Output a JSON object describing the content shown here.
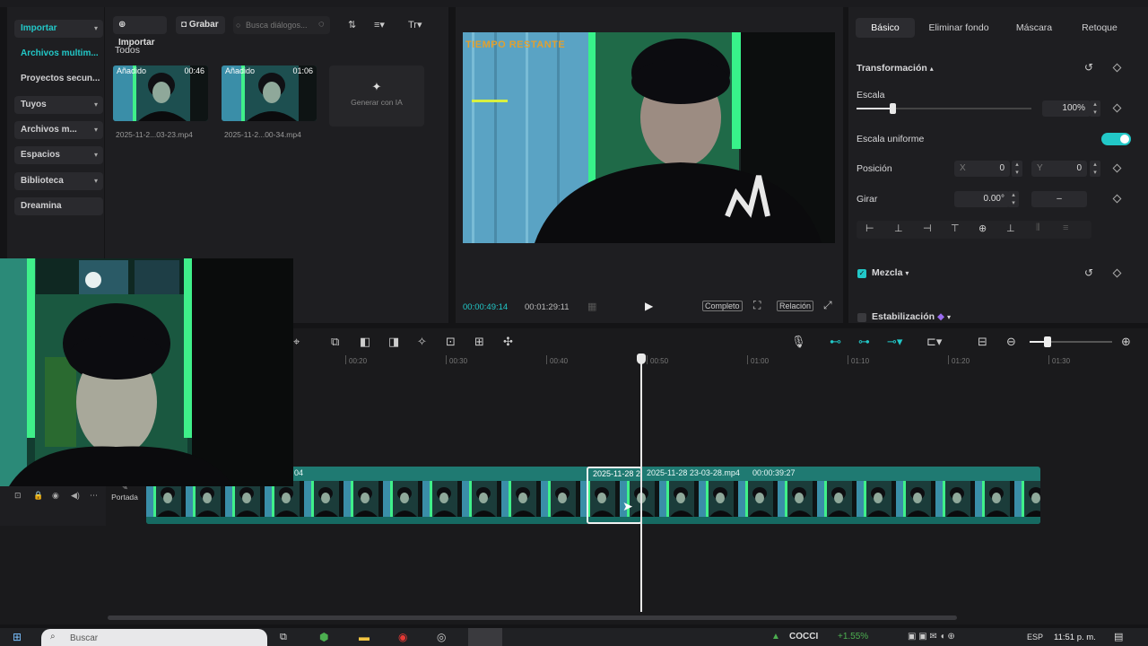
{
  "sidebar": {
    "items": [
      {
        "label": "Importar",
        "chevron": true,
        "active": true,
        "boxed": true
      },
      {
        "label": "Archivos multim...",
        "chevron": false,
        "active": true,
        "boxed": false
      },
      {
        "label": "Proyectos secun...",
        "chevron": false,
        "active": false,
        "boxed": false
      },
      {
        "label": "Tuyos",
        "chevron": true,
        "active": false,
        "boxed": true
      },
      {
        "label": "Archivos m...",
        "chevron": true,
        "active": false,
        "boxed": true
      },
      {
        "label": "Espacios",
        "chevron": true,
        "active": false,
        "boxed": true
      },
      {
        "label": "Biblioteca",
        "chevron": true,
        "active": false,
        "boxed": true
      },
      {
        "label": "Dreamina",
        "chevron": false,
        "active": false,
        "boxed": true
      }
    ]
  },
  "media": {
    "import_label": "Importar",
    "record_label": "Grabar",
    "search_placeholder": "Busca diálogos...",
    "section_label": "Todos",
    "clips": [
      {
        "badge": "Añadido",
        "duration": "00:46",
        "name": "2025-11-2...03-23.mp4"
      },
      {
        "badge": "Añadido",
        "duration": "01:06",
        "name": "2025-11-2...00-34.mp4"
      }
    ],
    "ai_card_label": "Generar con IA"
  },
  "preview": {
    "overlay_text": "TIEMPO RESTANTE",
    "current_time": "00:00:49:14",
    "total_time": "00:01:29:11",
    "complete_label": "Completo",
    "ratio_label": "Relación"
  },
  "inspector": {
    "tabs": [
      "Básico",
      "Eliminar fondo",
      "Máscara",
      "Retoque"
    ],
    "active_tab": "Básico",
    "transform_label": "Transformación",
    "scale_label": "Escala",
    "scale_value": "100%",
    "uniform_scale_label": "Escala uniforme",
    "position_label": "Posición",
    "pos_x_label": "X",
    "pos_x_value": "0",
    "pos_y_label": "Y",
    "pos_y_value": "0",
    "rotate_label": "Girar",
    "rotate_value": "0.00°",
    "rotate_dash": "–",
    "blend_label": "Mezcla",
    "stabilization_label": "Estabilización"
  },
  "timeline": {
    "ticks": [
      "00:20",
      "00:30",
      "00:40",
      "00:50",
      "01:00",
      "01:10",
      "01:20",
      "01:30"
    ],
    "cover_label": "Portada",
    "clip_left_label": "04",
    "clip_selected_label": "2025-11-28 2",
    "clip_right_label": "2025-11-28 23-03-28.mp4",
    "clip_right_duration": "00:00:39:27"
  },
  "taskbar": {
    "search_placeholder": "Buscar",
    "weather": "COCCI",
    "stock": "+1.55%",
    "lang": "ESP",
    "clock": "11:51 p. m."
  },
  "colors": {
    "accent": "#22c8c8",
    "timeline_clip": "#1f7a72",
    "playhead": "#e8e8e8"
  }
}
